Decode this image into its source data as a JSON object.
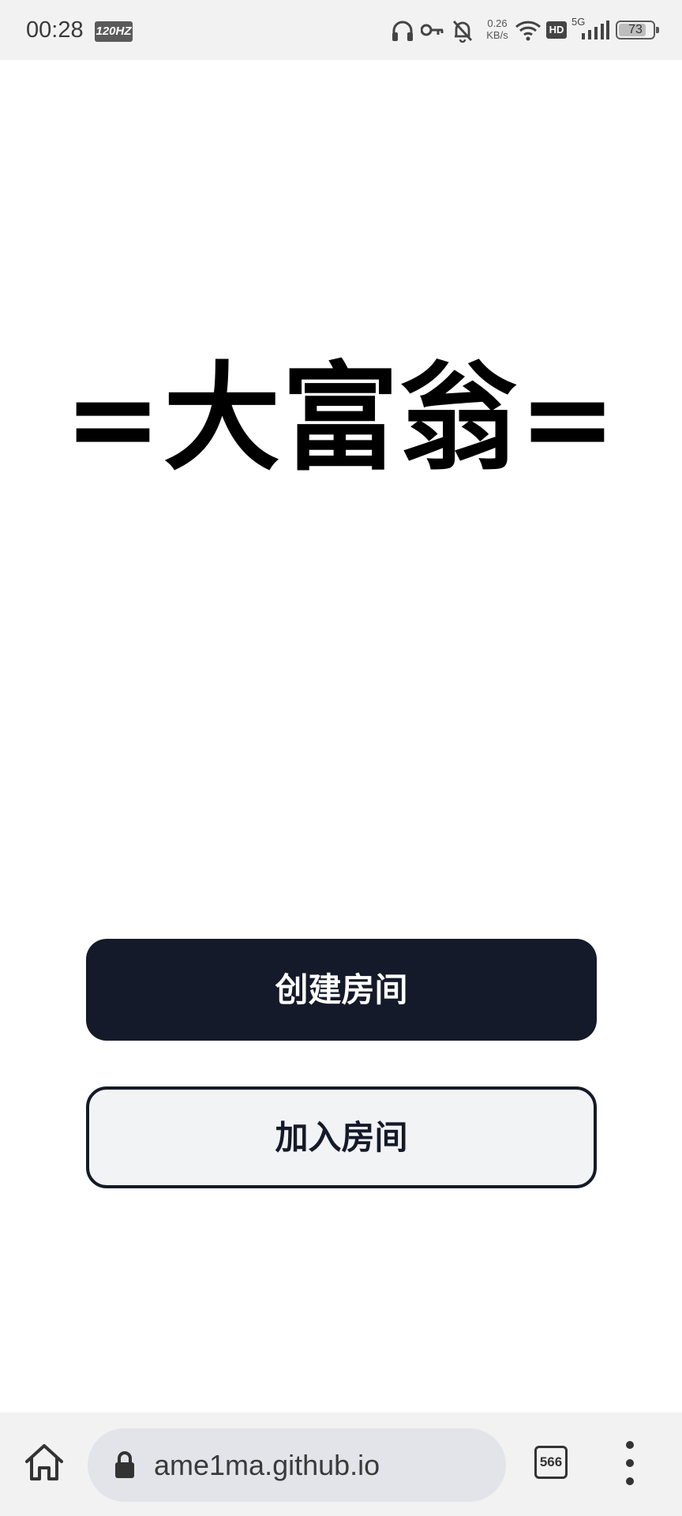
{
  "status_bar": {
    "time": "00:28",
    "refresh_badge": "120HZ",
    "net_speed_value": "0.26",
    "net_speed_unit": "KB/s",
    "hd_label": "HD",
    "network_type": "5G",
    "battery_level": "73",
    "icons": [
      "headphones-icon",
      "key-icon",
      "bell-off-icon",
      "wifi-icon",
      "hd-icon",
      "signal-icon",
      "battery-icon"
    ]
  },
  "main": {
    "title": "=大富翁=",
    "create_room_label": "创建房间",
    "join_room_label": "加入房间"
  },
  "colors": {
    "primary_button": "#141a29",
    "secondary_button_bg": "#f2f3f5",
    "background": "#ffffff"
  },
  "browser_bar": {
    "url": "ame1ma.github.io",
    "tab_count": "566",
    "icons": [
      "home-icon",
      "lock-icon",
      "tabs-icon",
      "more-vert-icon"
    ]
  }
}
